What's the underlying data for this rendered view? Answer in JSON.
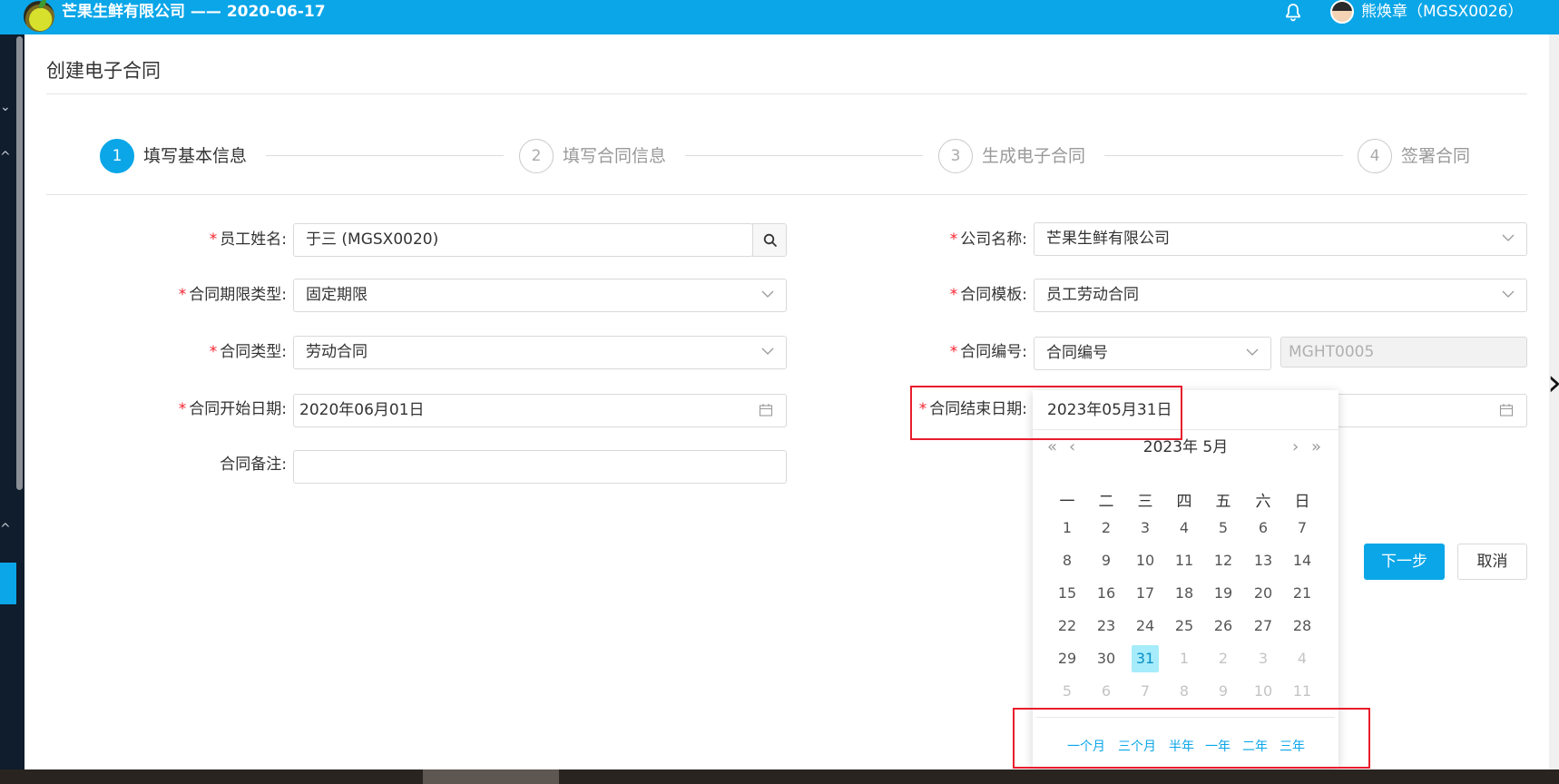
{
  "header": {
    "title": "芒果生鲜有限公司 —— 2020-06-17",
    "user": "熊焕章（MGSX0026）"
  },
  "page": {
    "title": "创建电子合同"
  },
  "steps": [
    {
      "num": "1",
      "label": "填写基本信息"
    },
    {
      "num": "2",
      "label": "填写合同信息"
    },
    {
      "num": "3",
      "label": "生成电子合同"
    },
    {
      "num": "4",
      "label": "签署合同"
    }
  ],
  "form": {
    "employee_label": "员工姓名:",
    "employee_value": "于三 (MGSX0020)",
    "term_type_label": "合同期限类型:",
    "term_type_value": "固定期限",
    "contract_type_label": "合同类型:",
    "contract_type_value": "劳动合同",
    "start_date_label": "合同开始日期:",
    "start_date_value": "2020年06月01日",
    "remark_label": "合同备注:",
    "remark_value": "",
    "company_label": "公司名称:",
    "company_value": "芒果生鲜有限公司",
    "template_label": "合同模板:",
    "template_value": "员工劳动合同",
    "number_label": "合同编号:",
    "number_select_value": "合同编号",
    "number_value": "MGHT0005",
    "end_date_label": "合同结束日期:",
    "required_mark": "*"
  },
  "buttons": {
    "next": "下一步",
    "cancel": "取消"
  },
  "datepicker": {
    "input_value": "2023年05月31日",
    "month_title": "2023年 5月",
    "prev_year": "«",
    "prev_month": "‹",
    "next_month": "›",
    "next_year": "»",
    "weekdays": [
      "一",
      "二",
      "三",
      "四",
      "五",
      "六",
      "日"
    ],
    "weeks": [
      [
        "1",
        "2",
        "3",
        "4",
        "5",
        "6",
        "7"
      ],
      [
        "8",
        "9",
        "10",
        "11",
        "12",
        "13",
        "14"
      ],
      [
        "15",
        "16",
        "17",
        "18",
        "19",
        "20",
        "21"
      ],
      [
        "22",
        "23",
        "24",
        "25",
        "26",
        "27",
        "28"
      ],
      [
        "29",
        "30",
        "31",
        "1",
        "2",
        "3",
        "4"
      ],
      [
        "5",
        "6",
        "7",
        "8",
        "9",
        "10",
        "11"
      ]
    ],
    "selected_day": "31",
    "presets": [
      "一个月",
      "三个月",
      "半年",
      "一年",
      "二年",
      "三年"
    ]
  }
}
